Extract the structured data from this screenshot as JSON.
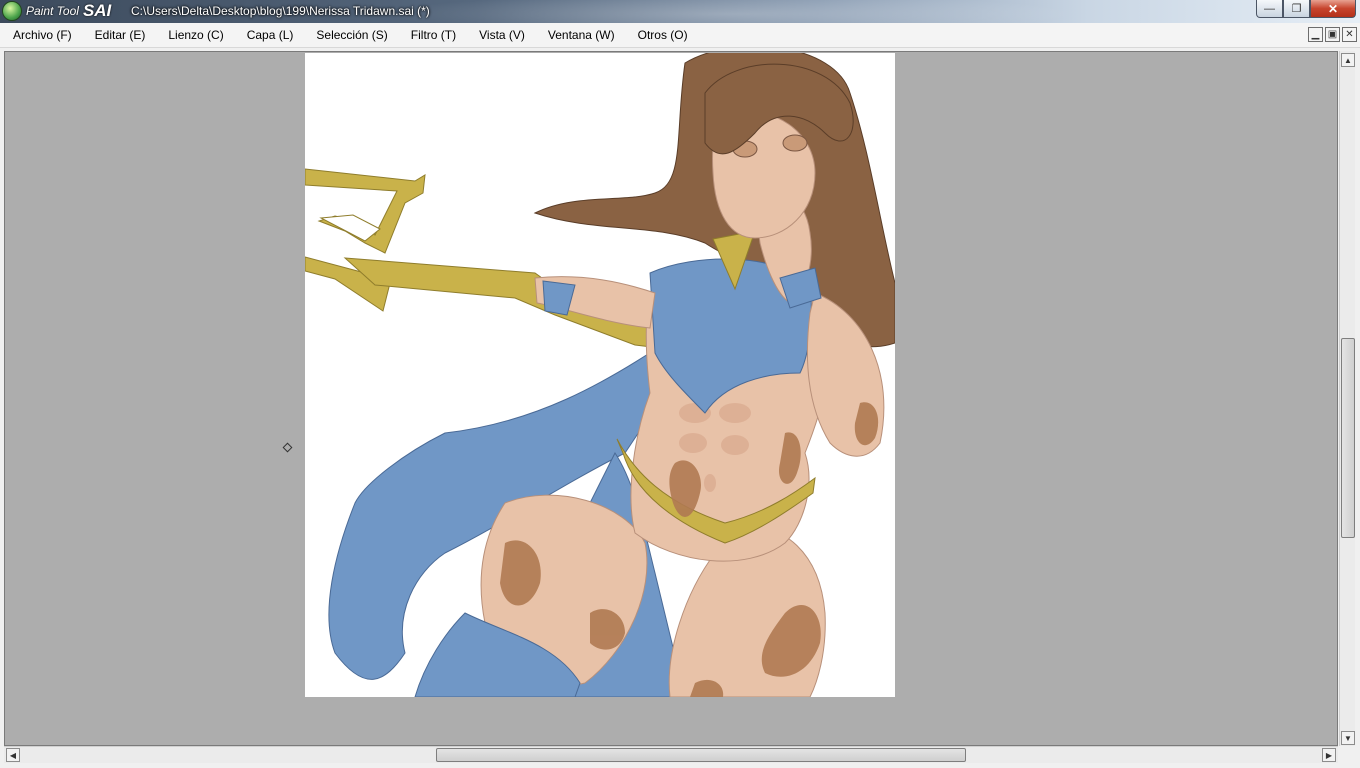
{
  "app": {
    "logo_text_small": "Paint Tool",
    "logo_text_large": "SAI",
    "window_title": "C:\\Users\\Delta\\Desktop\\blog\\199\\Nerissa Tridawn.sai (*)"
  },
  "window_buttons": {
    "minimize": "—",
    "maximize": "❐",
    "close": "✕"
  },
  "menu": [
    {
      "label": "Archivo (F)"
    },
    {
      "label": "Editar (E)"
    },
    {
      "label": "Lienzo (C)"
    },
    {
      "label": "Capa (L)"
    },
    {
      "label": "Selección (S)"
    },
    {
      "label": "Filtro (T)"
    },
    {
      "label": "Vista (V)"
    },
    {
      "label": "Ventana (W)"
    },
    {
      "label": "Otros (O)"
    }
  ],
  "document_buttons": {
    "minimize": "▁",
    "maximize": "▣",
    "close": "✕"
  },
  "canvas": {
    "artwork": "anime-style character illustration (woman with trident, blue cloth outfit)"
  },
  "scrollbars": {
    "up": "▲",
    "down": "▼",
    "left": "◀",
    "right": "▶"
  },
  "colors": {
    "workspace": "#adadad",
    "canvas_bg": "#ffffff",
    "skin": "#e8c2a8",
    "hair": "#8a6243",
    "cloth": "#7097c6",
    "gold": "#c9b24a",
    "mud": "#b07a52"
  }
}
